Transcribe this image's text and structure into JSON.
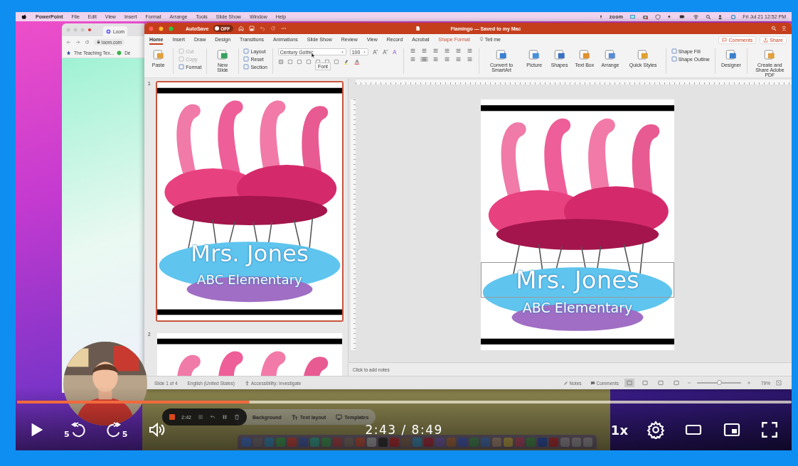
{
  "player": {
    "progress": {
      "level": 0.3
    },
    "rewind_label": "5",
    "forward_label": "5",
    "time": "2:43 / 8:49",
    "speed": "1x"
  },
  "menu_bar": {
    "app": "PowerPoint",
    "items": [
      "File",
      "Edit",
      "View",
      "Insert",
      "Format",
      "Arrange",
      "Tools",
      "Slide Show",
      "Window",
      "Help"
    ],
    "zoom": "zoom",
    "clock": "Fri Jul 21 12:52 PM"
  },
  "browser": {
    "tab": "Loom",
    "address": "loom.com",
    "bookmarks": [
      "The Teaching Tex...",
      "De"
    ]
  },
  "powerpoint": {
    "autosave": {
      "label": "AutoSave",
      "on": false,
      "state": "OFF"
    },
    "title": "Flamingo — Saved to my Mac",
    "tabs": [
      {
        "label": "Home",
        "kind": "tab",
        "selected": true
      },
      {
        "label": "Insert",
        "kind": "tab",
        "selected": false
      },
      {
        "label": "Draw",
        "kind": "tab",
        "selected": false
      },
      {
        "label": "Design",
        "kind": "tab",
        "selected": false
      },
      {
        "label": "Transitions",
        "kind": "tab",
        "selected": false
      },
      {
        "label": "Animations",
        "kind": "tab",
        "selected": false
      },
      {
        "label": "Slide Show",
        "kind": "tab",
        "selected": false
      },
      {
        "label": "Review",
        "kind": "tab",
        "selected": false
      },
      {
        "label": "View",
        "kind": "tab",
        "selected": false
      },
      {
        "label": "Record",
        "kind": "tab",
        "selected": false
      },
      {
        "label": "Acrobat",
        "kind": "tab",
        "selected": false
      },
      {
        "label": "Shape Format",
        "kind": "contextual",
        "selected": false
      },
      {
        "label": "Tell me",
        "kind": "search",
        "selected": false
      }
    ],
    "comments": "Comments",
    "share": "Share",
    "ribbon": [
      {
        "kind": "large",
        "label": "Paste"
      },
      {
        "kind": "stack",
        "items": [
          {
            "label": "Cut",
            "disabled": true
          },
          {
            "label": "Copy",
            "disabled": true
          },
          {
            "label": "Format",
            "disabled": false
          }
        ]
      },
      {
        "kind": "large",
        "label": "New Slide"
      },
      {
        "kind": "stack",
        "items": [
          {
            "label": "Layout",
            "disabled": false
          },
          {
            "label": "Reset",
            "disabled": false
          },
          {
            "label": "Section",
            "disabled": false
          }
        ]
      },
      {
        "kind": "font",
        "font": "Century Gothic",
        "size": "100"
      },
      {
        "kind": "paragraph"
      },
      {
        "kind": "large",
        "label": "Convert to SmartArt"
      },
      {
        "kind": "large",
        "label": "Picture"
      },
      {
        "kind": "large",
        "label": "Shapes"
      },
      {
        "kind": "large",
        "label": "Text Box"
      },
      {
        "kind": "large",
        "label": "Arrange"
      },
      {
        "kind": "large",
        "label": "Quick Styles"
      },
      {
        "kind": "stack",
        "items": [
          {
            "label": "Shape Fill",
            "disabled": false
          },
          {
            "label": "Shape Outline",
            "disabled": false
          }
        ]
      },
      {
        "kind": "large",
        "label": "Designer"
      },
      {
        "kind": "large",
        "label": "Create and Share Adobe PDF"
      }
    ],
    "tooltip": "Font",
    "thumbnails": [
      {
        "number": "1",
        "selected": true,
        "name": "Mrs. Jones",
        "school": "ABC Elementary"
      },
      {
        "number": "2",
        "selected": false
      }
    ],
    "slide": {
      "name": "Mrs. Jones",
      "school": "ABC Elementary"
    },
    "notes_placeholder": "Click to add notes",
    "status_bar": {
      "left": [
        "Slide 1 of 4",
        "English (United States)",
        "Accessibility: Investigate"
      ],
      "notes": "Notes",
      "comments": "Comments",
      "zoom": {
        "level": 0.5
      },
      "zoom_label": "79%"
    }
  },
  "loom_toolbar": {
    "timer": "2:42",
    "options": [
      "Background",
      "Text layout",
      "Templates"
    ]
  }
}
